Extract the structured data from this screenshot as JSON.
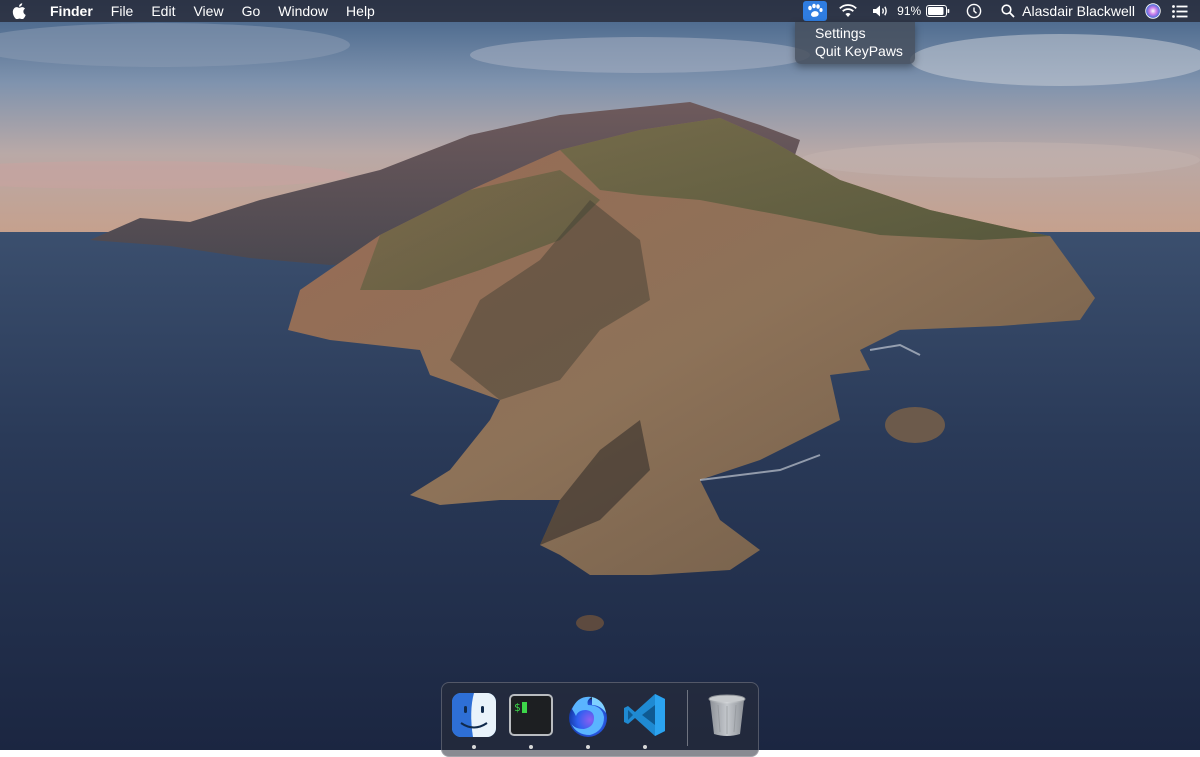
{
  "menubar": {
    "apple_icon": "apple-logo-icon",
    "app_name": "Finder",
    "menus": [
      "File",
      "Edit",
      "View",
      "Go",
      "Window",
      "Help"
    ],
    "status_icons": [
      "keypaws-paw-icon",
      "wifi-icon",
      "volume-icon",
      "battery-icon",
      "clock-icon",
      "spotlight-search-icon",
      "siri-icon",
      "notification-center-icon"
    ],
    "battery_percent": "91%",
    "battery_level": 0.91,
    "username": "Alasdair Blackwell",
    "active_status_color": "#2f7de1"
  },
  "dropdown": {
    "items": [
      "Settings",
      "Quit KeyPaws"
    ]
  },
  "dock": {
    "apps": [
      "Finder",
      "Terminal",
      "Firefox",
      "Visual Studio Code"
    ],
    "trash": "Trash",
    "running_apps": [
      "Finder",
      "Terminal",
      "Firefox",
      "Visual Studio Code"
    ]
  }
}
